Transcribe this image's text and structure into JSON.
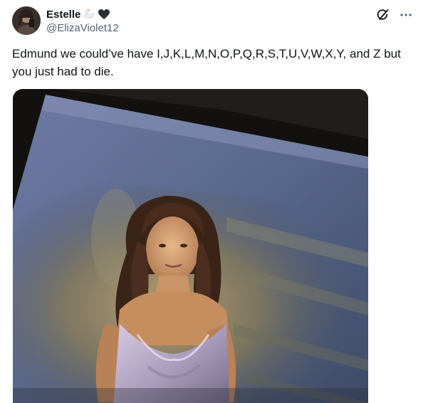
{
  "author": {
    "display_name": "Estelle",
    "handle": "@ElizaViolet12",
    "badges": [
      "swan-emoji",
      "black-heart-emoji"
    ]
  },
  "actions": {
    "grok_icon": "grok-icon",
    "more_icon": "more-dots-icon"
  },
  "tweet": {
    "text": "Edmund we could’ve have I,J,K,L,M,N,O,P,Q,R,S,T,U,V,W,X,Y, and Z but you just had to die."
  },
  "colors": {
    "text_primary": "#0f1419",
    "text_secondary": "#536471",
    "background": "#ffffff"
  }
}
